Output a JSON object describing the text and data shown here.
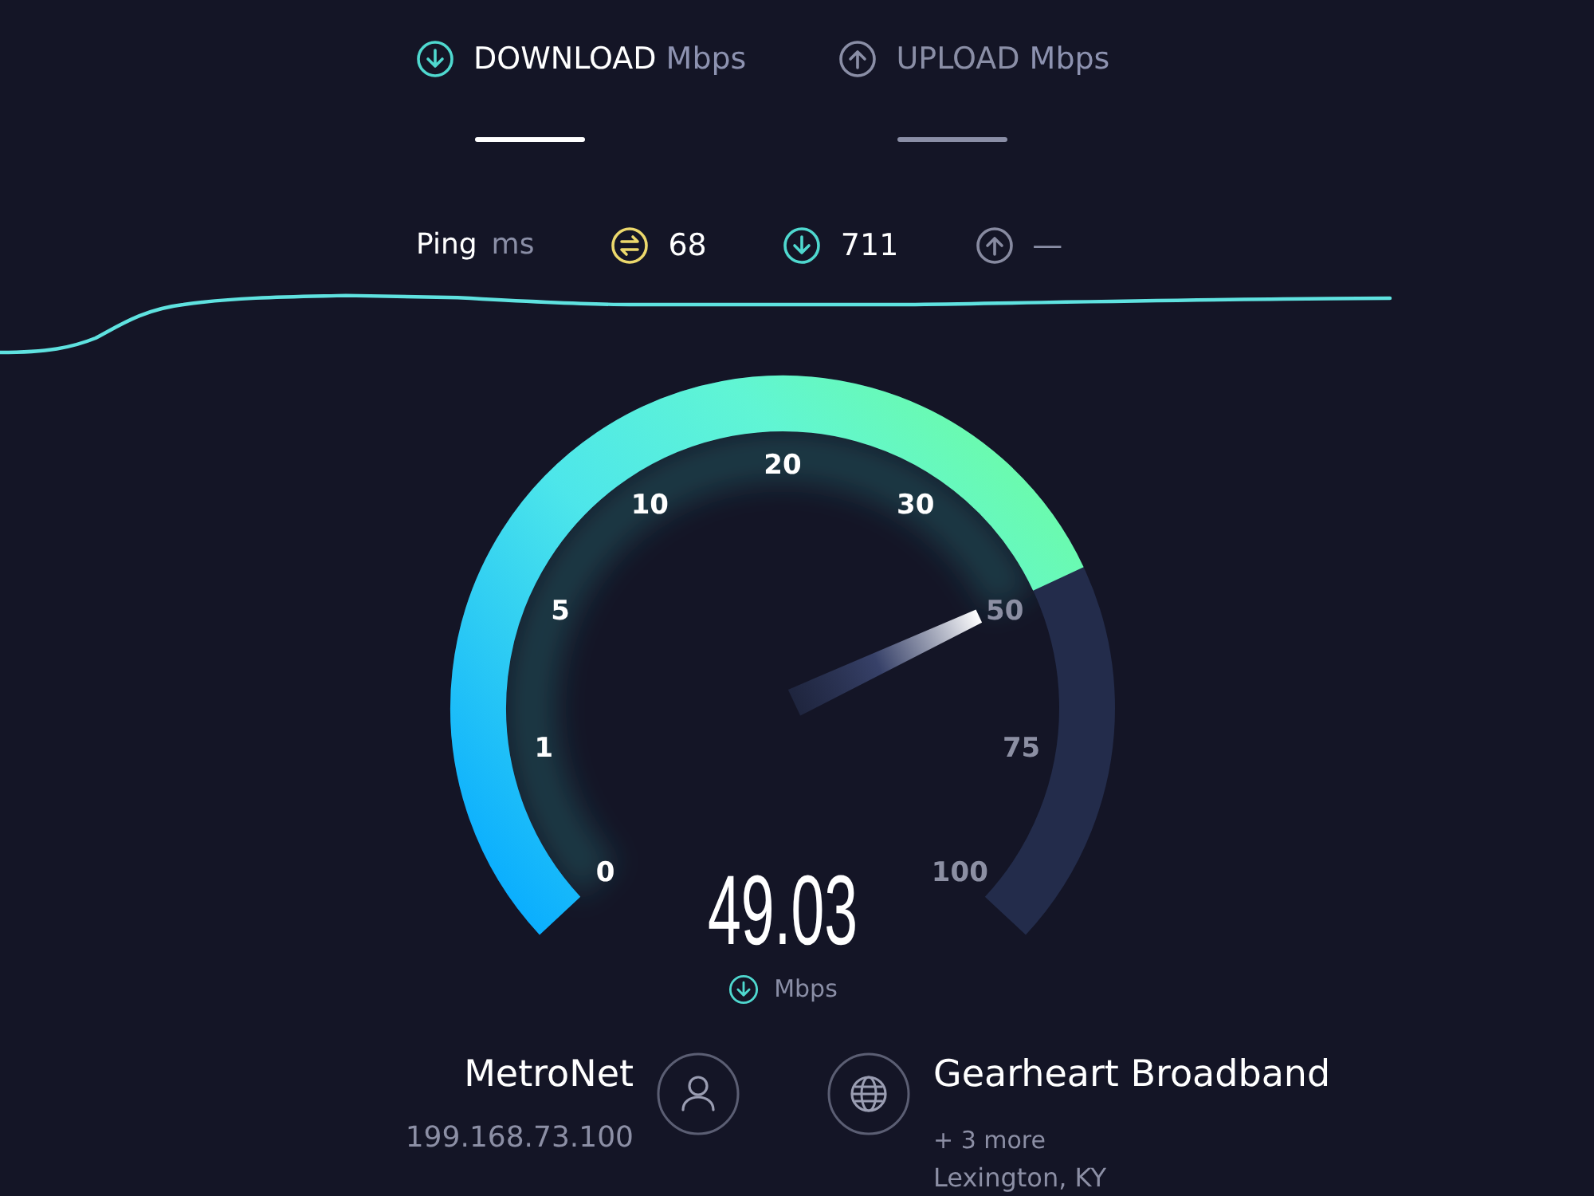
{
  "tabs": [
    {
      "kind": "download",
      "label": "DOWNLOAD",
      "unit": "Mbps",
      "selected": true
    },
    {
      "kind": "upload",
      "label": "UPLOAD",
      "unit": "Mbps",
      "selected": false
    }
  ],
  "ping": {
    "label": "Ping",
    "unit": "ms",
    "items": [
      {
        "kind": "idle",
        "value": "68",
        "color": "#ecd86c",
        "done": true
      },
      {
        "kind": "download",
        "value": "711",
        "color": "#4fd8cf",
        "done": true
      },
      {
        "kind": "upload",
        "value": "—",
        "color": "#878aa0",
        "done": false
      }
    ]
  },
  "gauge": {
    "kind": "download",
    "ticks": [
      "0",
      "1",
      "5",
      "10",
      "20",
      "30",
      "50",
      "75",
      "100"
    ],
    "level": 0.744,
    "value": "49.03",
    "unit": "Mbps"
  },
  "client": {
    "isp": "MetroNet",
    "ip": "199.168.73.100"
  },
  "server": {
    "name": "Gearheart Broadband",
    "more": "+ 3 more",
    "location": "Lexington, KY"
  }
}
